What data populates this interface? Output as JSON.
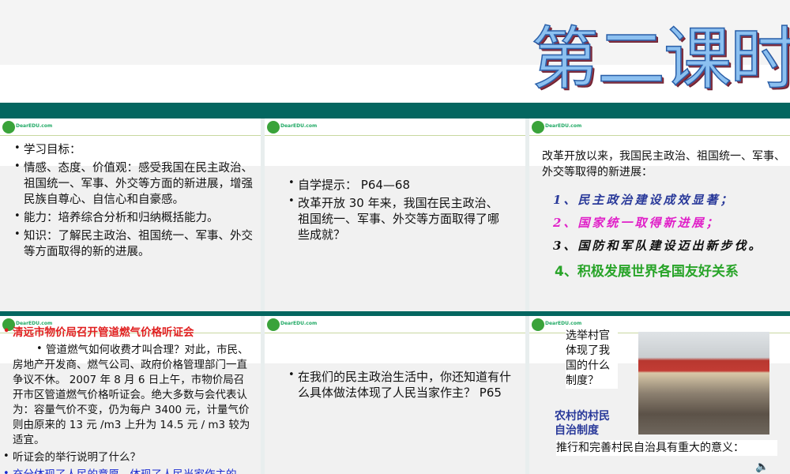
{
  "title": "第二课时",
  "logo": "DearEDU.com",
  "p1": {
    "items": [
      "学习目标：",
      "情感、态度、价值观：感受我国在民主政治、祖国统一、军事、外交等方面的新进展，增强民族自尊心、自信心和自豪感。",
      "能力：培养综合分析和归纳概括能力。",
      "知识：了解民主政治、祖国统一、军事、外交等方面取得的新的进展。"
    ]
  },
  "p2": {
    "items": [
      "自学提示： P64—68",
      "改革开放 30 年来，我国在民主政治、祖国统一、军事、外交等方面取得了哪些成就？"
    ]
  },
  "p3": {
    "intro": "改革开放以来，我国民主政治、祖国统一、军事、外交等取得的新进展：",
    "points": [
      "1、民主政治建设成效显著；",
      "2、国家统一取得新进展；",
      "3、国防和军队建设迈出新步伐。",
      "4、积极发展世界各国友好关系"
    ]
  },
  "p4": {
    "headline": "清远市物价局召开管道燃气价格听证会",
    "para": "管道燃气如何收费才叫合理？对此，市民、房地产开发商、燃气公司、政府价格管理部门一直争议不休。 2007 年 8 月 6 日上午，市物价局召开市区管道燃气价格听证会。绝大多数与会代表认为：容量气价不变，仍为每户 3400 元，计量气价则由原来的 13 元 /m3 上升为 14.5 元 / m3 较为适宜。",
    "question": "听证会的举行说明了什么？",
    "answer": "充分体现了人民的意愿，体现了人民当家作主的"
  },
  "p5": {
    "items": [
      "在我们的民主政治生活中，你还知道有什么具体做法体现了人民当家作主？ P65"
    ]
  },
  "p6": {
    "question": "选举村官体现了我国的什么制度？",
    "answer": "农村的村民自治制度",
    "footer": "推行和完善村民自治具有重大的意义："
  }
}
